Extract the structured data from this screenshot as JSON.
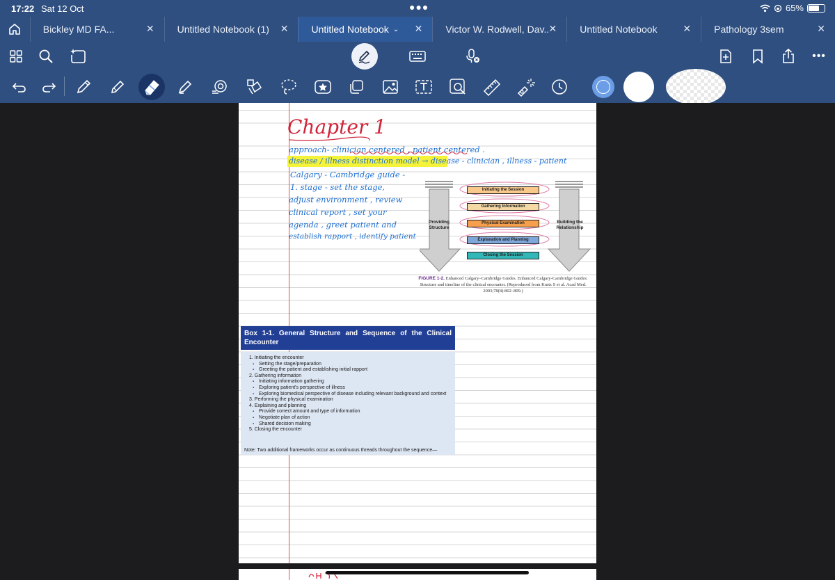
{
  "status": {
    "time": "17:22",
    "date": "Sat 12 Oct",
    "battery": "65%"
  },
  "tabs": [
    {
      "label": "Bickley MD  FA...",
      "active": false
    },
    {
      "label": "Untitled Notebook (1)",
      "active": false
    },
    {
      "label": "Untitled Notebook",
      "active": true
    },
    {
      "label": "Victor W. Rodwell, Dav...",
      "active": false
    },
    {
      "label": "Untitled Notebook",
      "active": false
    },
    {
      "label": "Pathology 3sem",
      "active": false
    }
  ],
  "colors": {
    "chrome": "#2f4f80",
    "active_tab": "#2f5a9a",
    "swatch_blue": "#6b9ee6",
    "ink_red": "#d1243a",
    "ink_blue": "#1e6fd0",
    "highlighter": "#f4f33a"
  },
  "note": {
    "title": "Chapter 1",
    "lines": [
      "approach- clinician centered , patient centered .",
      "disease / illness  distinction model  → disease - clinician , illness - patient",
      "Calgary - Cambridge  guide -",
      "1. stage - set  the  stage,",
      "adjust  environment , review",
      "clinical  report , set  your",
      "agenda , greet  patient  and",
      "establish  rapport , identify  patient"
    ]
  },
  "figure": {
    "left_label": "Providing\nStructure",
    "right_label": "Building the\nRelationship",
    "steps": [
      {
        "label": "Initiating the Session",
        "color": "#f9c98b"
      },
      {
        "label": "Gathering Information",
        "color": "#f4d9a5"
      },
      {
        "label": "Physical Examination",
        "color": "#f6a04d"
      },
      {
        "label": "Explanation and Planning",
        "color": "#7fa6d9"
      },
      {
        "label": "Closing the Session",
        "color": "#33b6b6"
      }
    ],
    "caption_num": "FIGURE 1-2.",
    "caption_text": "Enhanced Calgary–Cambridge Guides. Enhanced Calgary-Cambridge Guides: Structure and timeline of the clinical encounter. (Reproduced from Kurtz S et al. Acad Med. 2003;78(8):802–809.)"
  },
  "box": {
    "title": "Box 1-1. General Structure and Sequence of the Clinical Encounter",
    "items": [
      {
        "level": 1,
        "text": "1. Initiating the encounter"
      },
      {
        "level": 2,
        "text": "Setting the stage/preparation"
      },
      {
        "level": 2,
        "text": "Greeting the patient and establishing initial rapport"
      },
      {
        "level": 1,
        "text": "2. Gathering information"
      },
      {
        "level": 2,
        "text": "Initiating information gathering"
      },
      {
        "level": 2,
        "text": "Exploring patient's perspective of illness"
      },
      {
        "level": 2,
        "text": "Exploring biomedical perspective of disease including relevant background and context"
      },
      {
        "level": 1,
        "text": "3. Performing the physical examination"
      },
      {
        "level": 1,
        "text": "4. Explaining and planning"
      },
      {
        "level": 2,
        "text": "Provide correct amount and type of information"
      },
      {
        "level": 2,
        "text": "Negotiate plan of action"
      },
      {
        "level": 2,
        "text": "Shared decision making"
      },
      {
        "level": 1,
        "text": "5. Closing the encounter"
      }
    ],
    "note": "Note: Two additional frameworks occur as continuous threads throughout the sequence—"
  },
  "icons": {
    "toolbar1": [
      "grid-icon",
      "search-icon",
      "ai-sparkle-icon",
      "pen-mode-icon",
      "keyboard-icon",
      "mic-icon",
      "add-page-icon",
      "bookmark-icon",
      "share-icon",
      "more-icon"
    ],
    "toolbar2": [
      "undo-icon",
      "redo-icon",
      "pen-icon",
      "pencil-icon",
      "eraser-icon",
      "highlighter-icon",
      "shapes-icon",
      "elements-icon",
      "lasso-icon",
      "sticker-icon",
      "copy-icon",
      "image-icon",
      "text-icon",
      "zoom-icon",
      "ruler-icon",
      "laser-icon",
      "history-icon"
    ]
  }
}
